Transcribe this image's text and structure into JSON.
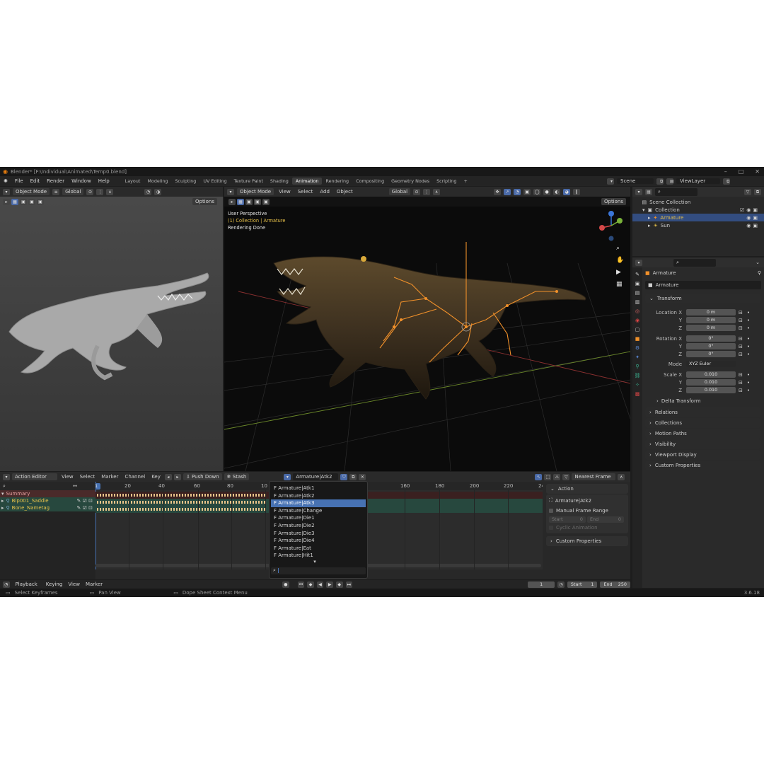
{
  "title": "Blender* [F:\\Individual\\Animated\\Temp0.blend]",
  "menu": [
    "File",
    "Edit",
    "Render",
    "Window",
    "Help"
  ],
  "workspaces": [
    "Layout",
    "Modeling",
    "Sculpting",
    "UV Editing",
    "Texture Paint",
    "Shading",
    "Animation",
    "Rendering",
    "Compositing",
    "Geometry Nodes",
    "Scripting"
  ],
  "active_workspace": "Animation",
  "scene": "Scene",
  "view_layer": "ViewLayer",
  "left_view": {
    "mode": "Object Mode",
    "orientation": "Global",
    "options": "Options"
  },
  "main_view": {
    "mode": "Object Mode",
    "menu": [
      "View",
      "Select",
      "Add",
      "Object"
    ],
    "orientation": "Global",
    "options": "Options",
    "overlay_line1": "User Perspective",
    "overlay_line2": "(1) Collection | Armature",
    "overlay_line3": "Rendering Done"
  },
  "outliner": {
    "rows": [
      {
        "label": "Scene Collection",
        "indent": 0
      },
      {
        "label": "Collection",
        "indent": 1
      },
      {
        "label": "Armature",
        "indent": 2
      },
      {
        "label": "Sun",
        "indent": 2
      }
    ]
  },
  "properties": {
    "object_name": "Armature",
    "data_name": "Armature",
    "transform_label": "Transform",
    "location": {
      "label": "Location X",
      "x": "0 m",
      "y": "0 m",
      "z": "0 m"
    },
    "rotation": {
      "label": "Rotation X",
      "x": "0°",
      "y": "0°",
      "z": "0°"
    },
    "mode_label": "Mode",
    "mode_value": "XYZ Euler",
    "scale": {
      "label": "Scale X",
      "x": "0.010",
      "y": "0.010",
      "z": "0.010"
    },
    "axis_y": "Y",
    "axis_z": "Z",
    "delta": "Delta Transform",
    "sections": [
      "Relations",
      "Collections",
      "Motion Paths",
      "Visibility",
      "Viewport Display",
      "Custom Properties"
    ]
  },
  "action_editor": {
    "editor": "Action Editor",
    "menu": [
      "View",
      "Select",
      "Marker",
      "Channel",
      "Key"
    ],
    "push_down": "Push Down",
    "stash": "Stash",
    "action": "Armature|Atk2",
    "snap": "Nearest Frame",
    "current_frame": "1",
    "ticks": [
      "20",
      "40",
      "60",
      "80",
      "10",
      "160",
      "180",
      "200",
      "220",
      "240"
    ],
    "channels": [
      "Summary",
      "Bip001_Saddle",
      "Bone_Nametag"
    ],
    "popup_items": [
      "F Armature|Atk1",
      "F Armature|Atk2",
      "F Armature|Atk3",
      "F Armature|Change",
      "F Armature|Die1",
      "F Armature|Die2",
      "F Armature|Die3",
      "F Armature|Die4",
      "F Armature|Eat",
      "F Armature|Hit1"
    ],
    "popup_selected": 2,
    "side": {
      "action_label": "Action",
      "action_name": "Armature|Atk2",
      "manual_range": "Manual Frame Range",
      "start_label": "Start",
      "start_val": "0",
      "end_label": "End",
      "end_val": "0",
      "cyclic": "Cyclic Animation",
      "custom_props": "Custom Properties"
    }
  },
  "timeline": {
    "menu": [
      "Playback",
      "Keying",
      "View",
      "Marker"
    ],
    "frame": "1",
    "start_label": "Start",
    "start": "1",
    "end_label": "End",
    "end": "250"
  },
  "status": {
    "left": "Select Keyframes",
    "mid": "Pan View",
    "right": "Dope Sheet Context Menu",
    "version": "3.6.18"
  },
  "colors": {
    "accent": "#4772b3",
    "bone": "#f0902a",
    "selected_text": "#e8c24a"
  }
}
